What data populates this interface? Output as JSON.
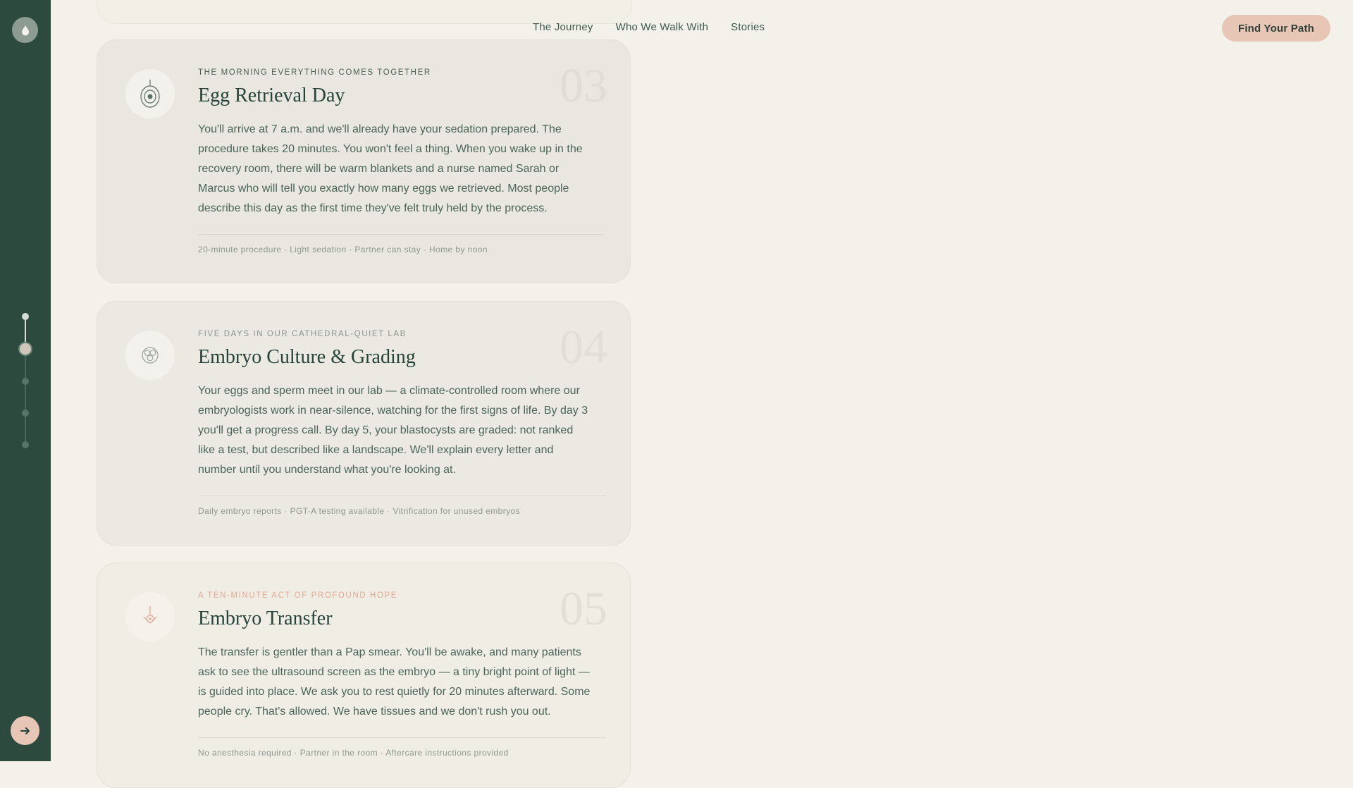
{
  "nav": {
    "items": [
      "The Journey",
      "Who We Walk With",
      "Stories"
    ],
    "cta": "Find Your Path"
  },
  "rail": {
    "logo_icon": "drop-icon",
    "steps_total": 5,
    "active_step": 2,
    "next_icon": "arrow-right-icon"
  },
  "colors": {
    "rail": "#2c4b3e",
    "accent": "#e8c6b6",
    "background": "#f4f1ea",
    "heading": "#24433a"
  },
  "cards": [
    {
      "number": "03",
      "eyebrow": "THE MORNING EVERYTHING COMES TOGETHER",
      "title": "Egg Retrieval Day",
      "text": "You'll arrive at 7 a.m. and we'll already have your sedation prepared. The procedure takes 20 minutes. You won't feel a thing. When you wake up in the recovery room, there will be warm blankets and a nurse named Sarah or Marcus who will tell you exactly how many eggs we retrieved. Most people describe this day as the first time they've felt truly held by the process.",
      "meta": "20-minute procedure · Light sedation · Partner can stay · Home by noon",
      "icon": "egg-icon"
    },
    {
      "number": "04",
      "eyebrow": "FIVE DAYS IN OUR CATHEDRAL-QUIET LAB",
      "title": "Embryo Culture & Grading",
      "text": "Your eggs and sperm meet in our lab — a climate-controlled room where our embryologists work in near-silence, watching for the first signs of life. By day 3 you'll get a progress call. By day 5, your blastocysts are graded: not ranked like a test, but described like a landscape. We'll explain every letter and number until you understand what you're looking at.",
      "meta": "Daily embryo reports · PGT-A testing available · Vitrification for unused embryos",
      "icon": "embryo-cells-icon"
    },
    {
      "number": "05",
      "eyebrow": "A TEN-MINUTE ACT OF PROFOUND HOPE",
      "title": "Embryo Transfer",
      "text": "The transfer is gentler than a Pap smear. You'll be awake, and many patients ask to see the ultrasound screen as the embryo — a tiny bright point of light — is guided into place. We ask you to rest quietly for 20 minutes afterward. Some people cry. That's allowed. We have tissues and we don't rush you out.",
      "meta": "No anesthesia required · Partner in the room · Aftercare instructions provided",
      "icon": "transfer-icon"
    }
  ]
}
